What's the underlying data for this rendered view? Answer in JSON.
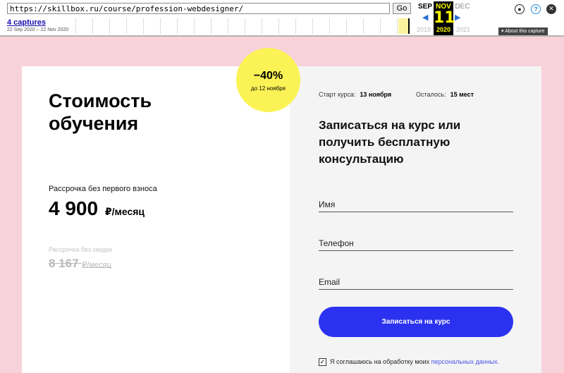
{
  "wayback": {
    "url": "https://skillbox.ru/course/profession-webdesigner/",
    "go_label": "Go",
    "captures_label": "4 captures",
    "capture_range": "22 Sep 2020 – 22 Nov 2020",
    "months": {
      "prev": "SEP",
      "current": "NOV",
      "next": "DEC"
    },
    "day": "11",
    "years": {
      "prev": "2019",
      "current": "2020",
      "next": "2021"
    },
    "about_label": "About this capture",
    "icons": [
      "user-icon",
      "help-icon",
      "close-icon"
    ]
  },
  "pricing": {
    "title": "Стоимость обучения",
    "promo_percent": "−40%",
    "promo_until": "до 12 ноября",
    "installment_label": "Рассрочка без первого взноса",
    "price": "4 900",
    "price_unit": "₽/месяц",
    "old_label": "Рассрочка без скидки",
    "old_price": "8 167",
    "old_unit": "₽/месяц"
  },
  "form": {
    "start_label": "Старт курса:",
    "start_value": "13 ноября",
    "remaining_label": "Осталось:",
    "remaining_value": "15 мест",
    "title": "Записаться на курс или получить бесплатную консультацию",
    "name_placeholder": "Имя",
    "phone_placeholder": "Телефон",
    "email_placeholder": "Email",
    "submit_label": "Записаться на курс",
    "consent_text": "Я соглашаюсь на обработку моих",
    "consent_link": "персональных данных."
  },
  "colors": {
    "background": "#f7d2da",
    "promo": "#fbf356",
    "button": "#2a31ef",
    "link": "#4b55e8"
  }
}
